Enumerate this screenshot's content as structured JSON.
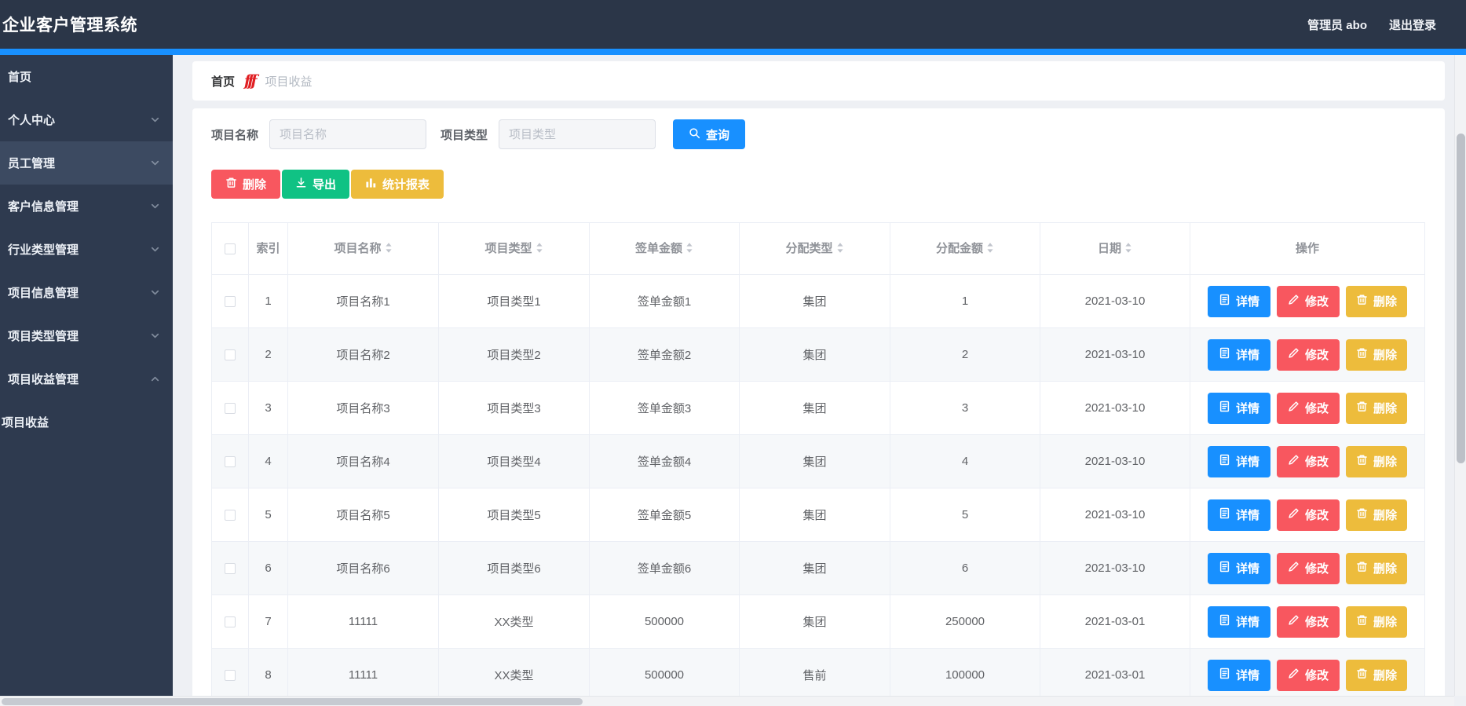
{
  "colors": {
    "navbar_bg": "#2b3648",
    "sidebar_bg": "#2e3a4f",
    "sidebar_active_bg": "#3c4a61",
    "accent_blue": "#1890ff",
    "danger_red": "#f8575f",
    "success_green": "#10c284",
    "warning_yellow": "#edbc3c",
    "breadcrumb_icon_red": "#e01f23"
  },
  "navbar": {
    "title": "企业客户管理系统",
    "user": "管理员 abo",
    "logout": "退出登录"
  },
  "sidebar": {
    "items": [
      {
        "id": "home",
        "label": "首页",
        "arrow": "none",
        "active": false,
        "sub": false
      },
      {
        "id": "profile",
        "label": "个人中心",
        "arrow": "down",
        "active": false,
        "sub": false
      },
      {
        "id": "employee-mgmt",
        "label": "员工管理",
        "arrow": "down",
        "active": true,
        "sub": false
      },
      {
        "id": "customer-info-mgmt",
        "label": "客户信息管理",
        "arrow": "down",
        "active": false,
        "sub": false
      },
      {
        "id": "industry-type-mgmt",
        "label": "行业类型管理",
        "arrow": "down",
        "active": false,
        "sub": false
      },
      {
        "id": "project-info-mgmt",
        "label": "项目信息管理",
        "arrow": "down",
        "active": false,
        "sub": false
      },
      {
        "id": "project-type-mgmt",
        "label": "项目类型管理",
        "arrow": "down",
        "active": false,
        "sub": false
      },
      {
        "id": "project-income-mgmt",
        "label": "项目收益管理",
        "arrow": "up",
        "active": false,
        "sub": false
      },
      {
        "id": "project-income",
        "label": "项目收益",
        "arrow": "none",
        "active": false,
        "sub": true
      }
    ]
  },
  "breadcrumb": {
    "home": "首页",
    "separator_glyph": "fff",
    "separator_icon": "breadcrumb-separator-icon",
    "current": "项目收益"
  },
  "search": {
    "name_label": "项目名称",
    "name_placeholder": "项目名称",
    "name_value": "",
    "type_label": "项目类型",
    "type_placeholder": "项目类型",
    "type_value": "",
    "query_label": "查询",
    "query_icon": "search-icon"
  },
  "toolbar": {
    "delete_label": "删除",
    "delete_icon": "trash-icon",
    "export_label": "导出",
    "export_icon": "download-icon",
    "report_label": "统计报表",
    "report_icon": "bar-chart-icon"
  },
  "table": {
    "headers": [
      {
        "label": "索引",
        "sortable": false
      },
      {
        "label": "项目名称",
        "sortable": true
      },
      {
        "label": "项目类型",
        "sortable": true
      },
      {
        "label": "签单金额",
        "sortable": true
      },
      {
        "label": "分配类型",
        "sortable": true
      },
      {
        "label": "分配金额",
        "sortable": true
      },
      {
        "label": "日期",
        "sortable": true
      },
      {
        "label": "操作",
        "sortable": false
      }
    ],
    "rows": [
      {
        "index": "1",
        "name": "项目名称1",
        "type": "项目类型1",
        "amount": "签单金额1",
        "alloc_type": "集团",
        "alloc_amount": "1",
        "date": "2021-03-10"
      },
      {
        "index": "2",
        "name": "项目名称2",
        "type": "项目类型2",
        "amount": "签单金额2",
        "alloc_type": "集团",
        "alloc_amount": "2",
        "date": "2021-03-10"
      },
      {
        "index": "3",
        "name": "项目名称3",
        "type": "项目类型3",
        "amount": "签单金额3",
        "alloc_type": "集团",
        "alloc_amount": "3",
        "date": "2021-03-10"
      },
      {
        "index": "4",
        "name": "项目名称4",
        "type": "项目类型4",
        "amount": "签单金额4",
        "alloc_type": "集团",
        "alloc_amount": "4",
        "date": "2021-03-10"
      },
      {
        "index": "5",
        "name": "项目名称5",
        "type": "项目类型5",
        "amount": "签单金额5",
        "alloc_type": "集团",
        "alloc_amount": "5",
        "date": "2021-03-10"
      },
      {
        "index": "6",
        "name": "项目名称6",
        "type": "项目类型6",
        "amount": "签单金额6",
        "alloc_type": "集团",
        "alloc_amount": "6",
        "date": "2021-03-10"
      },
      {
        "index": "7",
        "name": "11111",
        "type": "XX类型",
        "amount": "500000",
        "alloc_type": "集团",
        "alloc_amount": "250000",
        "date": "2021-03-01"
      },
      {
        "index": "8",
        "name": "11111",
        "type": "XX类型",
        "amount": "500000",
        "alloc_type": "售前",
        "alloc_amount": "100000",
        "date": "2021-03-01"
      }
    ],
    "actions": {
      "detail_label": "详情",
      "detail_icon": "document-icon",
      "edit_label": "修改",
      "edit_icon": "pencil-icon",
      "delete_label": "删除",
      "delete_icon": "trash-icon"
    }
  }
}
